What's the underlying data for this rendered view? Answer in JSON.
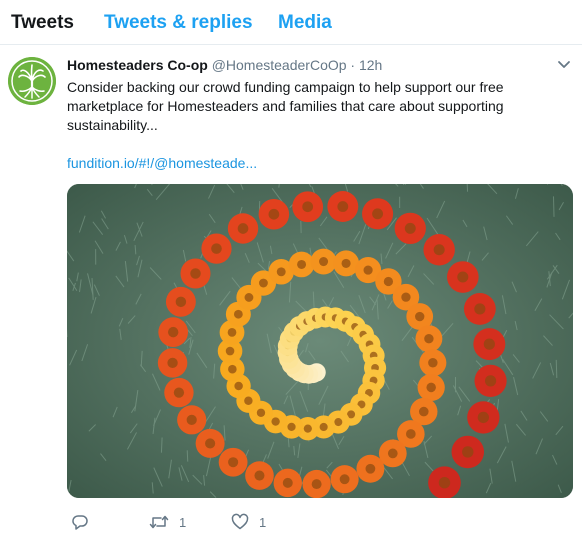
{
  "tabs": [
    {
      "label": "Tweets",
      "active": true
    },
    {
      "label": "Tweets & replies",
      "active": false
    },
    {
      "label": "Media",
      "active": false
    }
  ],
  "tweet": {
    "name": "Homesteaders Co-op",
    "handle": "@HomesteaderCoOp",
    "separator": "·",
    "time": "12h",
    "text_lines": [
      "Consider backing our crowd funding campaign to help support our free",
      "marketplace for Homesteaders and families that care about supporting",
      "sustainability..."
    ],
    "link": "fundition.io/#!/@homesteade...",
    "actions": {
      "reply_count": "",
      "retweet_count": "1",
      "like_count": "1"
    }
  },
  "icons": {
    "caret": "chevron-down-icon",
    "reply": "reply-icon",
    "retweet": "retweet-icon",
    "like": "heart-icon"
  },
  "colors": {
    "accent": "#1da1f2",
    "link": "#1b95e0",
    "muted": "#657786",
    "avatar_green": "#6db33f"
  }
}
